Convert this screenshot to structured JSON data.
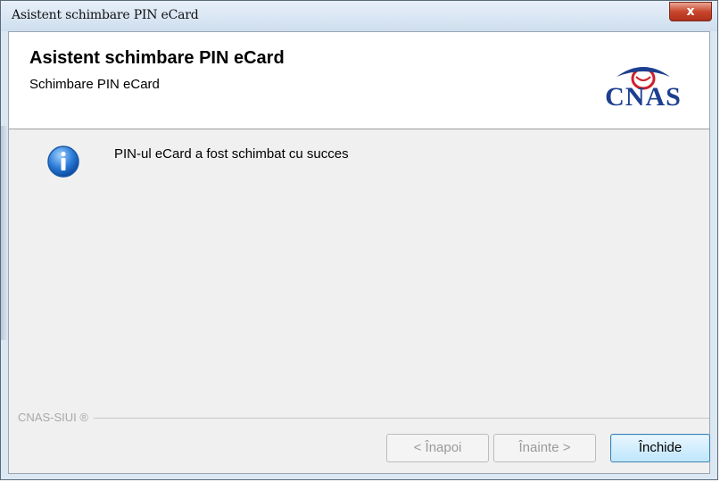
{
  "window": {
    "title": "Asistent schimbare PIN eCard",
    "close_label": "x"
  },
  "header": {
    "title": "Asistent schimbare PIN eCard",
    "subtitle": "Schimbare PIN eCard",
    "logo_text": "CNAS"
  },
  "content": {
    "icon": "info-icon",
    "message": "PIN-ul eCard a fost schimbat cu succes"
  },
  "footer": {
    "brand": "CNAS-SIUI ®",
    "buttons": {
      "back": "< Înapoi",
      "next": "Înainte >",
      "close": "Închide"
    }
  },
  "colors": {
    "logo_blue": "#1d3f8f",
    "logo_red": "#d0202a",
    "primary_button_border": "#3c7fb1"
  }
}
